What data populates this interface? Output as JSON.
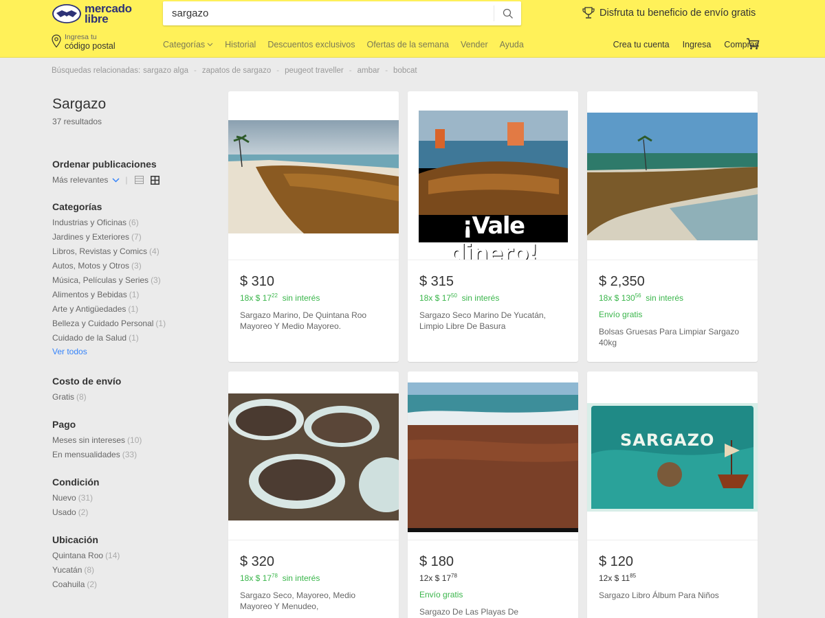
{
  "header": {
    "logo_line1": "mercado",
    "logo_line2": "libre",
    "search_value": "sargazo",
    "promo_text": "Disfruta tu beneficio de envío gratis",
    "location_line1": "Ingresa tu",
    "location_line2": "código postal",
    "nav": [
      "Categorías",
      "Historial",
      "Descuentos exclusivos",
      "Ofertas de la semana",
      "Vender",
      "Ayuda"
    ],
    "user_nav": [
      "Crea tu cuenta",
      "Ingresa",
      "Compras"
    ]
  },
  "related": {
    "label": "Búsquedas relacionadas:",
    "items": [
      "sargazo alga",
      "zapatos de sargazo",
      "peugeot traveller",
      "ambar",
      "bobcat"
    ]
  },
  "sidebar": {
    "title": "Sargazo",
    "results": "37 resultados",
    "sort_title": "Ordenar publicaciones",
    "sort_value": "Más relevantes",
    "categories_title": "Categorías",
    "categories": [
      {
        "label": "Industrias y Oficinas",
        "count": "(6)"
      },
      {
        "label": "Jardines y Exteriores",
        "count": "(7)"
      },
      {
        "label": "Libros, Revistas y Comics",
        "count": "(4)"
      },
      {
        "label": "Autos, Motos y Otros",
        "count": "(3)"
      },
      {
        "label": "Música, Películas y Series",
        "count": "(3)"
      },
      {
        "label": "Alimentos y Bebidas",
        "count": "(1)"
      },
      {
        "label": "Arte y Antigüedades",
        "count": "(1)"
      },
      {
        "label": "Belleza y Cuidado Personal",
        "count": "(1)"
      },
      {
        "label": "Cuidado de la Salud",
        "count": "(1)"
      }
    ],
    "see_all": "Ver todos",
    "shipping_title": "Costo de envío",
    "shipping": [
      {
        "label": "Gratis",
        "count": "(8)"
      }
    ],
    "payment_title": "Pago",
    "payment": [
      {
        "label": "Meses sin intereses",
        "count": "(10)"
      },
      {
        "label": "En mensualidades",
        "count": "(33)"
      }
    ],
    "condition_title": "Condición",
    "condition": [
      {
        "label": "Nuevo",
        "count": "(31)"
      },
      {
        "label": "Usado",
        "count": "(2)"
      }
    ],
    "location_title": "Ubicación",
    "location": [
      {
        "label": "Quintana Roo",
        "count": "(14)"
      },
      {
        "label": "Yucatán",
        "count": "(8)"
      },
      {
        "label": "Coahuila",
        "count": "(2)"
      }
    ]
  },
  "products": [
    {
      "price": "$ 310",
      "inst_prefix": "18x $ 17",
      "inst_cents": "22",
      "inst_suffix": "sin interés",
      "shipping": "",
      "title": "Sargazo Marino, De Quintana Roo Mayoreo Y Medio Mayoreo."
    },
    {
      "price": "$ 315",
      "inst_prefix": "18x $ 17",
      "inst_cents": "50",
      "inst_suffix": "sin interés",
      "shipping": "",
      "title": "Sargazo Seco Marino De Yucatán, Limpio Libre De Basura",
      "overlay_text": "¡Vale dinero!"
    },
    {
      "price": "$ 2,350",
      "inst_prefix": "18x $ 130",
      "inst_cents": "56",
      "inst_suffix": "sin interés",
      "shipping": "Envío gratis",
      "title": "Bolsas Gruesas Para Limpiar Sargazo 40kg"
    },
    {
      "price": "$ 320",
      "inst_prefix": "18x $ 17",
      "inst_cents": "78",
      "inst_suffix": "sin interés",
      "shipping": "",
      "title": "Sargazo Seco, Mayoreo, Medio Mayoreo Y Menudeo,"
    },
    {
      "price": "$ 180",
      "inst_prefix": "12x $ 17",
      "inst_cents": "78",
      "inst_suffix": "",
      "shipping": "Envío gratis",
      "title": "Sargazo De Las Playas De"
    },
    {
      "price": "$ 120",
      "inst_prefix": "12x $ 11",
      "inst_cents": "85",
      "inst_suffix": "",
      "shipping": "",
      "title": "Sargazo Libro Álbum Para Niños",
      "overlay_text": "SARGAZO"
    }
  ],
  "colors": {
    "header": "#fff159",
    "green": "#39b54a",
    "blue": "#3483fa"
  }
}
